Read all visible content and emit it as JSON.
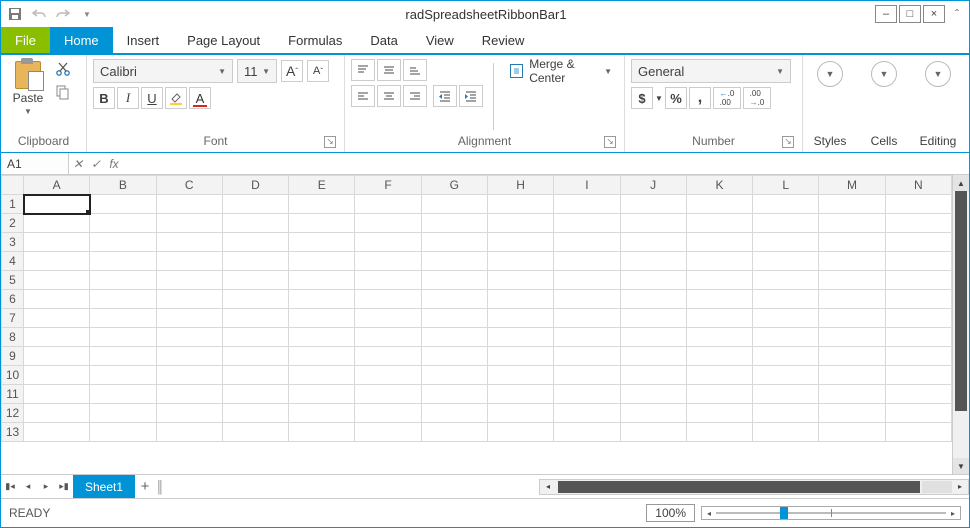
{
  "window": {
    "title": "radSpreadsheetRibbonBar1"
  },
  "tabs": {
    "file": "File",
    "items": [
      "Home",
      "Insert",
      "Page Layout",
      "Formulas",
      "Data",
      "View",
      "Review"
    ],
    "active": "Home"
  },
  "ribbon": {
    "clipboard": {
      "label": "Clipboard",
      "paste": "Paste"
    },
    "font": {
      "label": "Font",
      "family": "Calibri",
      "size": "11",
      "grow": "A˄",
      "shrink": "A˅",
      "bold": "B",
      "italic": "I",
      "underline": "U"
    },
    "alignment": {
      "label": "Alignment",
      "merge": "Merge & Center"
    },
    "number": {
      "label": "Number",
      "format": "General",
      "currency": "$",
      "percent": "%",
      "comma": ",",
      "inc": ".0 .00",
      "dec": ".00 .0"
    },
    "styles": "Styles",
    "cells": "Cells",
    "editing": "Editing"
  },
  "formula_bar": {
    "name": "A1",
    "fx": "fx"
  },
  "grid": {
    "columns": [
      "A",
      "B",
      "C",
      "D",
      "E",
      "F",
      "G",
      "H",
      "I",
      "J",
      "K",
      "L",
      "M",
      "N"
    ],
    "rows": [
      "1",
      "2",
      "3",
      "4",
      "5",
      "6",
      "7",
      "8",
      "9",
      "10",
      "11",
      "12",
      "13"
    ],
    "selected": "A1"
  },
  "sheets": {
    "active": "Sheet1"
  },
  "status": {
    "ready": "READY",
    "zoom": "100%"
  }
}
